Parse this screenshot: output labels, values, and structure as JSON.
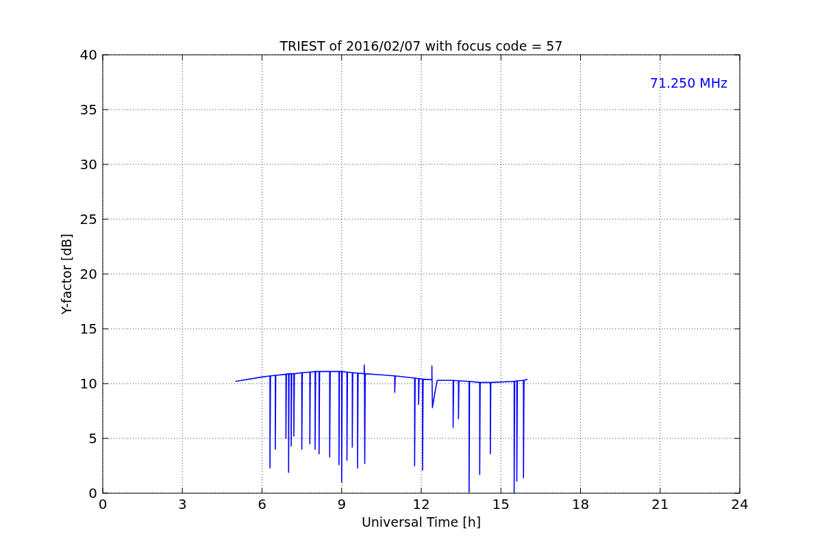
{
  "chart_data": {
    "type": "line",
    "title": "TRIEST of 2016/02/07 with focus code = 57",
    "xlabel": "Universal Time [h]",
    "ylabel": "Y-factor [dB]",
    "xlim": [
      0,
      24
    ],
    "ylim": [
      0,
      40
    ],
    "xticks": [
      0,
      3,
      6,
      9,
      12,
      15,
      18,
      21,
      24
    ],
    "yticks": [
      0,
      5,
      10,
      15,
      20,
      25,
      30,
      35,
      40
    ],
    "grid": true,
    "x": [
      5.0,
      6.0,
      6.3,
      6.3,
      6.32,
      6.5,
      6.5,
      6.52,
      6.9,
      6.9,
      6.92,
      7.0,
      7.0,
      7.02,
      7.1,
      7.1,
      7.12,
      7.2,
      7.2,
      7.22,
      7.5,
      7.5,
      7.52,
      7.8,
      7.8,
      7.82,
      8.0,
      8.0,
      8.02,
      8.15,
      8.15,
      8.17,
      8.55,
      8.55,
      8.57,
      8.9,
      8.9,
      8.92,
      9.0,
      9.0,
      9.02,
      9.2,
      9.2,
      9.22,
      9.4,
      9.4,
      9.42,
      9.6,
      9.6,
      9.62,
      9.85,
      9.85,
      9.86,
      9.87,
      9.89,
      10.5,
      11.0,
      11.0,
      11.02,
      11.75,
      11.75,
      11.77,
      11.9,
      11.9,
      11.92,
      12.05,
      12.05,
      12.07,
      12.4,
      12.4,
      12.42,
      12.5,
      12.6,
      13.2,
      13.2,
      13.22,
      13.4,
      13.4,
      13.42,
      13.8,
      13.8,
      13.82,
      14.2,
      14.2,
      14.22,
      14.6,
      14.6,
      14.62,
      15.5,
      15.5,
      15.52,
      15.6,
      15.6,
      15.62,
      15.85,
      15.85,
      15.87,
      16.0
    ],
    "series": [
      {
        "name": "71.250 MHz",
        "color": "#0000ff",
        "values": [
          10.2,
          10.6,
          10.7,
          2.3,
          10.7,
          10.75,
          4.0,
          10.75,
          10.85,
          5.0,
          10.85,
          10.9,
          1.9,
          10.9,
          10.9,
          4.3,
          10.9,
          10.9,
          5.2,
          10.9,
          11.0,
          4.0,
          11.0,
          11.05,
          4.5,
          11.05,
          11.1,
          4.0,
          11.1,
          11.1,
          3.6,
          11.1,
          11.1,
          3.3,
          11.1,
          11.1,
          2.6,
          11.1,
          11.1,
          1.0,
          11.1,
          11.05,
          3.0,
          11.05,
          11.0,
          4.2,
          11.0,
          10.95,
          2.3,
          10.95,
          10.9,
          11.7,
          10.9,
          2.7,
          10.9,
          10.8,
          10.7,
          9.2,
          10.7,
          10.5,
          2.5,
          10.5,
          10.45,
          8.1,
          10.45,
          10.4,
          2.1,
          10.4,
          10.35,
          11.6,
          7.8,
          9.0,
          10.3,
          10.3,
          6.0,
          10.3,
          10.25,
          6.8,
          10.25,
          10.2,
          0.1,
          10.2,
          10.1,
          1.7,
          10.1,
          10.1,
          3.6,
          10.1,
          10.2,
          0.0,
          10.2,
          10.25,
          1.1,
          10.25,
          10.3,
          1.4,
          10.3,
          10.4
        ]
      }
    ]
  }
}
